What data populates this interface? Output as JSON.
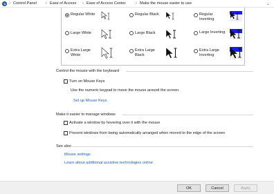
{
  "breadcrumb": {
    "items": [
      "Control Panel",
      "Ease of Access",
      "Ease of Access Center",
      "Make the mouse easier to use"
    ]
  },
  "scheme": {
    "options": [
      {
        "label": "Regular White",
        "checked": true,
        "style": "white"
      },
      {
        "label": "Regular Black",
        "checked": false,
        "style": "black"
      },
      {
        "label": "Regular Inverting",
        "checked": false,
        "style": "inverting"
      },
      {
        "label": "Large White",
        "checked": false,
        "style": "white"
      },
      {
        "label": "Large Black",
        "checked": false,
        "style": "black"
      },
      {
        "label": "Large Inverting",
        "checked": false,
        "style": "inverting"
      },
      {
        "label": "Extra Large White",
        "checked": false,
        "style": "white"
      },
      {
        "label": "Extra Large Black",
        "checked": false,
        "style": "black"
      },
      {
        "label": "Extra Large Inverting",
        "checked": false,
        "style": "inverting"
      }
    ]
  },
  "mouse_keys": {
    "title": "Control the mouse with the keyboard",
    "checkbox_label": "Turn on Mouse Keys",
    "description": "Use the numeric keypad to move the mouse around the screen.",
    "setup_link": "Set up Mouse Keys"
  },
  "windows": {
    "title": "Make it easier to manage windows",
    "hover_label": "Activate a window by hovering over it with the mouse",
    "arrange_label": "Prevent windows from being automatically arranged when moved to the edge of the screen"
  },
  "see_also": {
    "title": "See also",
    "links": [
      "Mouse settings",
      "Learn about additional assistive technologies online"
    ]
  },
  "buttons": {
    "ok": "OK",
    "cancel": "Cancel",
    "apply": "Apply"
  },
  "colors": {
    "accent": "#1c5fb8",
    "inverting_blue": "#1a1aff"
  }
}
